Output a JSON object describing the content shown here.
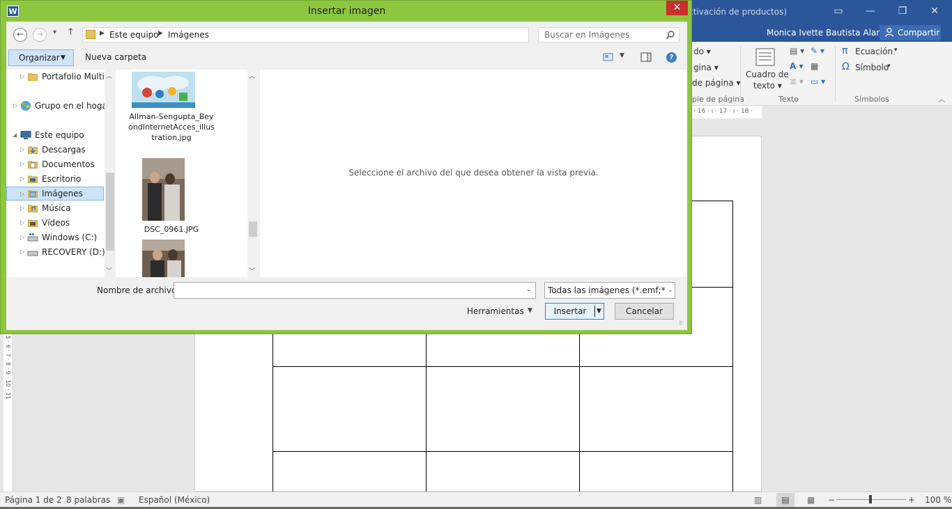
{
  "word": {
    "title_partial": "ctivación de productos)",
    "user_name": "Monica Ivette Bautista Alaniz",
    "share_label": "Compartir",
    "ribbon": {
      "partial_items": [
        "do ▾",
        "gina ▾",
        "de página ▾"
      ],
      "partial_group_label": "pie de página",
      "cuadro_de_texto": "Cuadro de",
      "cuadro_de_texto_2": "texto ▾",
      "texto_group_label": "Texto",
      "ecuacion": "Ecuación",
      "simbolo": "Símbolo",
      "simbolos_group_label": "Símbolos"
    },
    "ruler_text": "· 16 · ı · 17 · ı · 18 ·",
    "vruler_text": "5 · 6 · 7 · 8 · 9 · 10 · 11",
    "status": {
      "page": "Página 1 de 2",
      "words": "8 palabras",
      "language": "Español (México)",
      "zoom": "100 %"
    }
  },
  "dialog": {
    "title": "Insertar imagen",
    "app_icon": "W",
    "address": [
      "Este equipo",
      "Imágenes"
    ],
    "search_placeholder": "Buscar en Imágenes",
    "organize_label": "Organizar",
    "new_folder_label": "Nueva carpeta",
    "tree": [
      {
        "label": "Portafolio Multin",
        "icon": "folder-icon",
        "indent": 1,
        "expander": "▷"
      },
      {
        "label": "Grupo en el hogar",
        "icon": "homegroup-icon",
        "indent": 0,
        "expander": "▷"
      },
      {
        "label": "Este equipo",
        "icon": "computer-icon",
        "indent": 0,
        "expander": "◢"
      },
      {
        "label": "Descargas",
        "icon": "downloads-icon",
        "indent": 1,
        "expander": "▷"
      },
      {
        "label": "Documentos",
        "icon": "documents-icon",
        "indent": 1,
        "expander": "▷"
      },
      {
        "label": "Escritorio",
        "icon": "desktop-icon",
        "indent": 1,
        "expander": "▷"
      },
      {
        "label": "Imágenes",
        "icon": "pictures-icon",
        "indent": 1,
        "expander": "▷",
        "selected": true
      },
      {
        "label": "Música",
        "icon": "music-icon",
        "indent": 1,
        "expander": "▷"
      },
      {
        "label": "Vídeos",
        "icon": "videos-icon",
        "indent": 1,
        "expander": "▷"
      },
      {
        "label": "Windows (C:)",
        "icon": "drive-c-icon",
        "indent": 1,
        "expander": "▷"
      },
      {
        "label": "RECOVERY (D:)",
        "icon": "drive-d-icon",
        "indent": 1,
        "expander": "▷"
      }
    ],
    "files": [
      {
        "name": "Allman-Sengupta_BeyondInternetAcces_illustration.jpg"
      },
      {
        "name": "DSC_0961.JPG"
      },
      {
        "name": ""
      }
    ],
    "preview_message": "Seleccione el archivo del que desea obtener la vista previa.",
    "filename_label": "Nombre de archivo:",
    "filename_value": "",
    "filetype_value": "Todas las imágenes (*.emf;*.wmf;*.jpg;*.jpeg;*.jfif;*.jpe;*.png;*.bmp;*.dib;*.rle;*.gif;*.emz;*.wmz;*.tif;*.tiff;*.svg;*.ico)",
    "tools_label": "Herramientas",
    "insert_label": "Insertar",
    "cancel_label": "Cancelar"
  },
  "colors": {
    "dialog_frame": "#8dc63f",
    "word_blue": "#2b579a",
    "close_red": "#c7302b",
    "selection": "#cce4f7"
  }
}
